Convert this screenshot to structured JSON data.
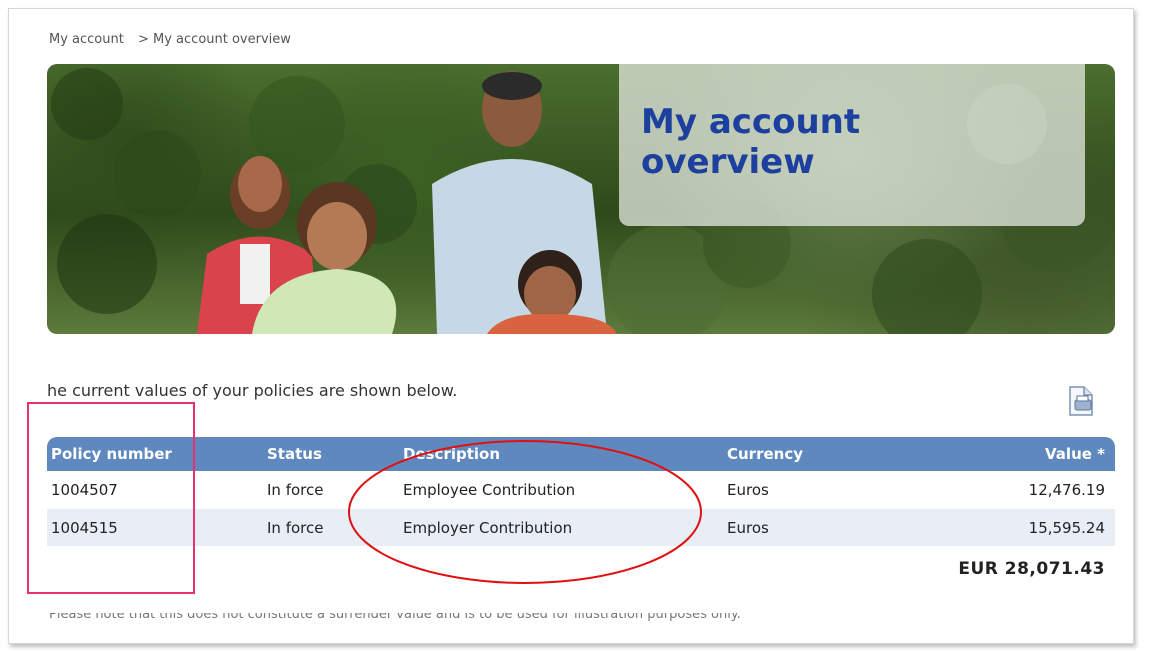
{
  "breadcrumb": [
    "My account",
    "> My account overview"
  ],
  "banner": {
    "title": "My account overview"
  },
  "intro_text": "he current values of your policies are shown below.",
  "table": {
    "headers": {
      "policy_number": "Policy number",
      "status": "Status",
      "description": "Description",
      "currency": "Currency",
      "value": "Value *"
    },
    "rows": [
      {
        "policy_number": "1004507",
        "status": "In force",
        "description": "Employee Contribution",
        "currency": "Euros",
        "value": "12,476.19"
      },
      {
        "policy_number": "1004515",
        "status": "In force",
        "description": "Employer Contribution",
        "currency": "Euros",
        "value": "15,595.24"
      }
    ],
    "total": "EUR 28,071.43"
  },
  "footnote": "Please note that this does not constitute a surrender value and is to be used for illustration purposes only.",
  "icons": {
    "print": "print-icon"
  },
  "colors": {
    "header_bg": "#5f88bf",
    "title": "#1d3f9e",
    "annotation_rect": "#e8306b",
    "annotation_ellipse": "#e01010"
  }
}
